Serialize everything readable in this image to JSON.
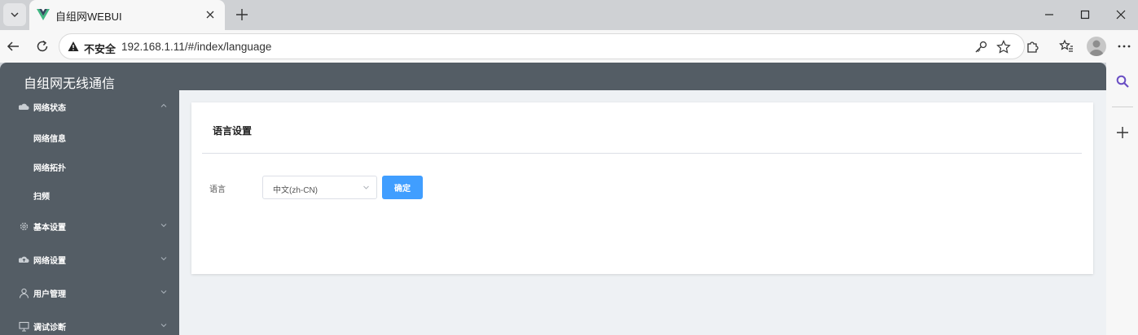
{
  "browser": {
    "tab_title": "自组网WEBUI",
    "security_label": "不安全",
    "url": "192.168.1.11/#/index/language"
  },
  "app": {
    "title": "自组网无线通信"
  },
  "sidebar": {
    "groups": [
      {
        "label": "网络状态",
        "icon": "cloud-icon",
        "expanded": true,
        "items": [
          {
            "label": "网络信息"
          },
          {
            "label": "网络拓扑"
          },
          {
            "label": "扫频"
          }
        ]
      },
      {
        "label": "基本设置",
        "icon": "gear-icon",
        "expanded": false
      },
      {
        "label": "网络设置",
        "icon": "cloud-upload-icon",
        "expanded": false
      },
      {
        "label": "用户管理",
        "icon": "user-icon",
        "expanded": false
      },
      {
        "label": "调试诊断",
        "icon": "monitor-icon",
        "expanded": false
      }
    ]
  },
  "card": {
    "title": "语言设置",
    "language_label": "语言",
    "language_value": "中文(zh-CN)",
    "confirm_label": "确定"
  },
  "colors": {
    "sidebar_bg": "#545d65",
    "primary": "#409eff",
    "page_bg": "#eef1f4"
  }
}
